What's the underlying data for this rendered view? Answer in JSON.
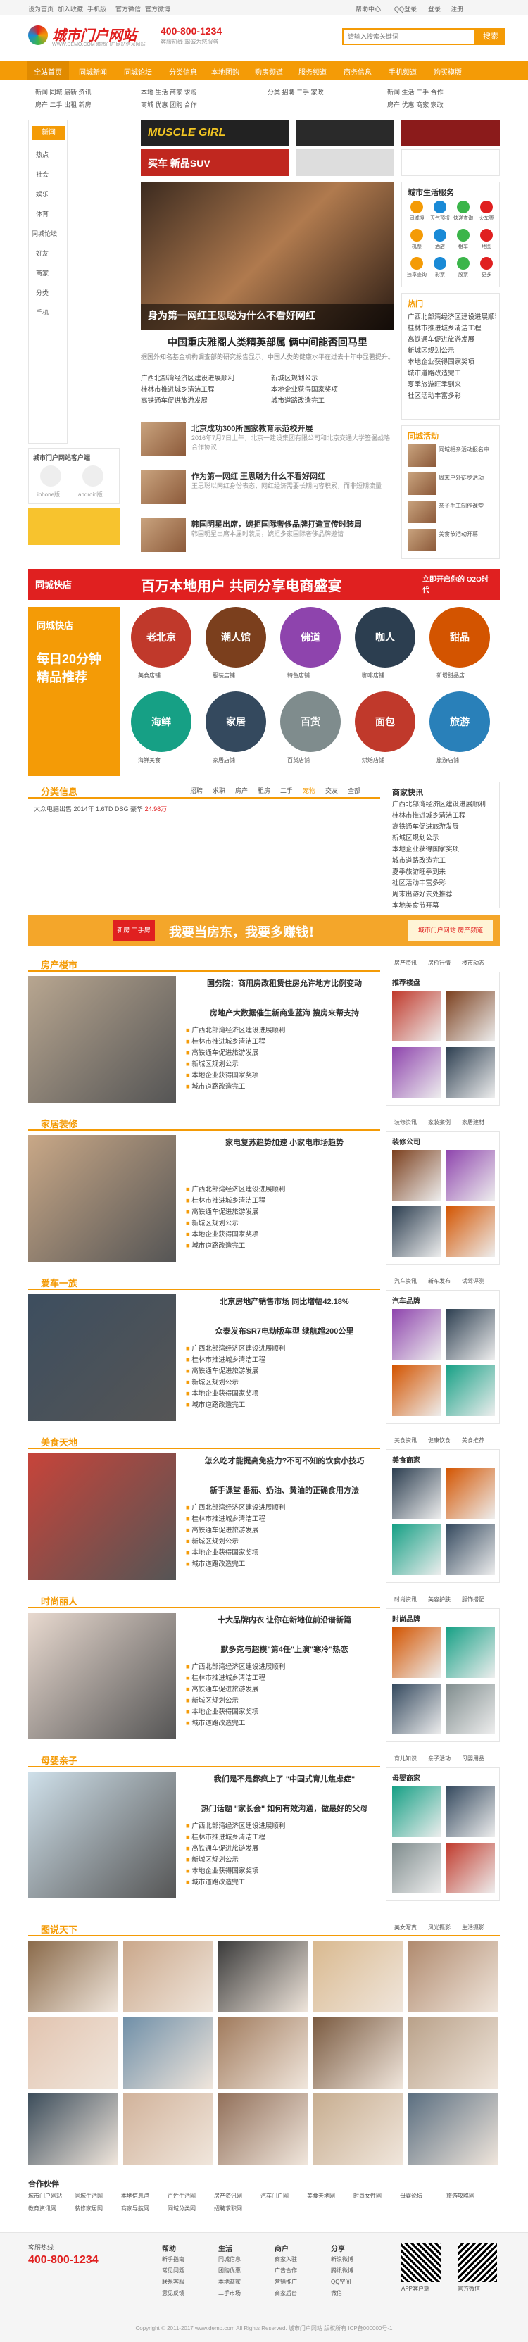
{
  "topbar": {
    "left1": "设为首页",
    "left2": "加入收藏",
    "left3": "手机版",
    "left4": "官方微信",
    "left5": "官方微博",
    "right1": "帮助中心",
    "right2": "QQ登录",
    "right3": "登录",
    "right4": "注册"
  },
  "header": {
    "logo": "城市门户网站",
    "logo_sub": "WWW.DEMO.COM 城市门户网站信息网站",
    "phone": "400-800-1234",
    "phone_sub": "客服热线 竭诚为您服务",
    "search_placeholder": "请输入搜索关键词",
    "search_btn": "搜索"
  },
  "nav": [
    "全站首页",
    "同城新闻",
    "同城论坛",
    "分类信息",
    "本地团购",
    "购房频道",
    "服务频道",
    "商务信息",
    "手机频道",
    "购买模版"
  ],
  "subnav": [
    [
      "新闻",
      "同城",
      "最新",
      "资讯"
    ],
    [
      "房产",
      "二手",
      "出租",
      "新房"
    ],
    [
      "本地",
      "生活",
      "商家",
      "求购"
    ],
    [
      "商城",
      "优惠",
      "团购",
      "合作"
    ],
    [
      "分类",
      "招聘",
      "二手",
      "家政"
    ]
  ],
  "side": {
    "items": [
      "新闻",
      "热点",
      "社会",
      "娱乐",
      "体育",
      "同城论坛",
      "好友",
      "商家",
      "分类",
      "手机"
    ],
    "app_title": "城市门户网站客户端",
    "iphone": "iphone版",
    "android": "android版"
  },
  "banner1": "MUSCLE GIRL",
  "banner2": "买车 新品SUV",
  "feature": {
    "caption": "身为第一网红王思聪为什么不看好网红",
    "headline": "中国重庆雅阁人类精英部属 俩中间能否回马里",
    "desc1": "据国外知名基金机构调查部的研究报告显示，中国人类的健康水平在过去十年中显著提升。"
  },
  "news": [
    {
      "t": "北京成功300所国家教育示范校开展",
      "d": "2016年7月7日上午，北京一建设集团有限公司和北京交通大学签署战略合作协议"
    },
    {
      "t": "作为第一网红 王思聪为什么不看好网红",
      "d": "王思聪以网红身份表态，网红经济需要长期内容积累，而非短期流量"
    },
    {
      "t": "韩国明星出席，婉拒国际奢侈品牌打造宣传时装周",
      "d": "韩国明星出席本届时装周，婉拒多家国际奢侈品牌邀请"
    }
  ],
  "quick": {
    "title": "城市生活服务",
    "items": [
      "同城搜",
      "天气预报",
      "快递查询",
      "火车票",
      "机票",
      "酒店",
      "租车",
      "地图",
      "违章查询",
      "彩票",
      "股票",
      "更多"
    ]
  },
  "right_news": {
    "title": "热门",
    "items": [
      "广西北部湾经济区建设进展顺利",
      "桂林市推进城乡清洁工程",
      "高铁通车促进旅游发展",
      "新城区规划公示",
      "本地企业获得国家奖项",
      "城市道路改造完工",
      "夏季旅游旺季到来",
      "社区活动丰富多彩"
    ]
  },
  "right_forum": {
    "title": "同城活动",
    "items": [
      "同城相亲活动报名中",
      "周末户外徒步活动",
      "亲子手工制作课堂",
      "美食节活动开幕"
    ]
  },
  "promo": {
    "logo": "同城快店",
    "slogan": "百万本地用户 共同分享电商盛宴",
    "tag": "立即开启你的 O2O时代"
  },
  "shop_slogan": "每日20分钟 精品推荐",
  "shops": [
    {
      "n": "老北京",
      "s": "美食店铺"
    },
    {
      "n": "潮人馆",
      "s": "服装店铺"
    },
    {
      "n": "佛道",
      "s": "特色店铺"
    },
    {
      "n": "咖人",
      "s": "咖啡店铺"
    },
    {
      "n": "甜品",
      "s": "新增甜品店"
    },
    {
      "n": "海鲜",
      "s": "海鲜美食"
    },
    {
      "n": "家居",
      "s": "家居店铺"
    },
    {
      "n": "百货",
      "s": "百货店铺"
    },
    {
      "n": "面包",
      "s": "烘焙店铺"
    },
    {
      "n": "旅游",
      "s": "旅游店铺"
    }
  ],
  "classified": {
    "title": "分类信息",
    "tabs": [
      "招聘",
      "求职",
      "房产",
      "租房",
      "二手",
      "宠物",
      "交友",
      "全部"
    ],
    "row": "大众电脑出售 2014年 1.6TD DSG 豪华",
    "price": "24.98万"
  },
  "shop_right": {
    "title": "商家快讯",
    "items": [
      "广西北部湾经济区建设进展顺利",
      "桂林市推进城乡清洁工程",
      "高铁通车促进旅游发展",
      "新城区规划公示",
      "本地企业获得国家奖项",
      "城市道路改造完工",
      "夏季旅游旺季到来",
      "社区活动丰富多彩",
      "周末出游好去处推荐",
      "本地美食节开幕"
    ]
  },
  "ad2": {
    "text": "我要当房东，我要多赚钱！",
    "left": "新房 二手房",
    "right": "城市门户网站 房产频道"
  },
  "sections": [
    {
      "title": "房产楼市",
      "head": "国务院：商用房改租赁住房允许地方比例变动",
      "sub": "房地产大数据催生新商业蓝海 搜房来帮支持",
      "right_title": "推荐楼盘",
      "tabs": [
        "房产资讯",
        "房价行情",
        "楼市动态"
      ]
    },
    {
      "title": "家居装修",
      "head": "家电复苏趋势加速 小家电市场趋势",
      "sub": "",
      "right_title": "装修公司",
      "tabs": [
        "装修资讯",
        "家装案例",
        "家居建材"
      ]
    },
    {
      "title": "爱车一族",
      "head": "北京房地产销售市场 同比增幅42.18%",
      "sub": "众泰发布SR7电动版车型 续航超200公里",
      "right_title": "汽车品牌",
      "tabs": [
        "汽车资讯",
        "新车发布",
        "试驾评测"
      ]
    },
    {
      "title": "美食天地",
      "head": "怎么吃才能提高免疫力?不可不知的饮食小技巧",
      "sub": "新手课堂 番茄、奶油、黄油的正确食用方法",
      "right_title": "美食商家",
      "tabs": [
        "美食资讯",
        "健康饮食",
        "美食推荐"
      ]
    },
    {
      "title": "时尚丽人",
      "head": "十大品牌内衣 让你在新地位前沿谱新篇",
      "sub": "默多克与超模\"第4任\"上演\"寒冷\"热恋",
      "right_title": "时尚品牌",
      "tabs": [
        "时尚资讯",
        "美容护肤",
        "服饰搭配"
      ]
    },
    {
      "title": "母婴亲子",
      "head": "我们是不是都疯上了 \"中国式育儿焦虑症\"",
      "sub": "热门话题 \"家长会\" 如何有效沟通，做最好的父母",
      "right_title": "母婴商家",
      "tabs": [
        "育儿知识",
        "亲子活动",
        "母婴用品"
      ]
    }
  ],
  "photo": {
    "title": "图说天下",
    "tabs": [
      "美女写真",
      "风光摄影",
      "生活摄影"
    ]
  },
  "friend": {
    "title": "合作伙伴",
    "links": [
      "城市门户网站",
      "同城生活网",
      "本地信息港",
      "百姓生活网",
      "房产资讯网",
      "汽车门户网",
      "美食天地网",
      "时尚女性网",
      "母婴论坛",
      "旅游攻略网",
      "教育资讯网",
      "装修家居网",
      "商家导航网",
      "同城分类网",
      "招聘求职网"
    ]
  },
  "footer": {
    "phone_label": "客服热线",
    "phone": "400-800-1234",
    "cols": [
      {
        "t": "帮助",
        "items": [
          "新手指南",
          "常见问题",
          "联系客服",
          "意见反馈"
        ]
      },
      {
        "t": "生活",
        "items": [
          "同城信息",
          "团购优惠",
          "本地商家",
          "二手市场"
        ]
      },
      {
        "t": "商户",
        "items": [
          "商家入驻",
          "广告合作",
          "营销推广",
          "商家后台"
        ]
      },
      {
        "t": "分享",
        "items": [
          "新浪微博",
          "腾讯微博",
          "QQ空间",
          "微信"
        ]
      }
    ],
    "qr1": "APP客户端",
    "qr2": "官方微信",
    "copyright": "Copyright © 2011-2017 www.demo.com All Rights Reserved. 城市门户网站 版权所有 ICP备000000号-1"
  }
}
